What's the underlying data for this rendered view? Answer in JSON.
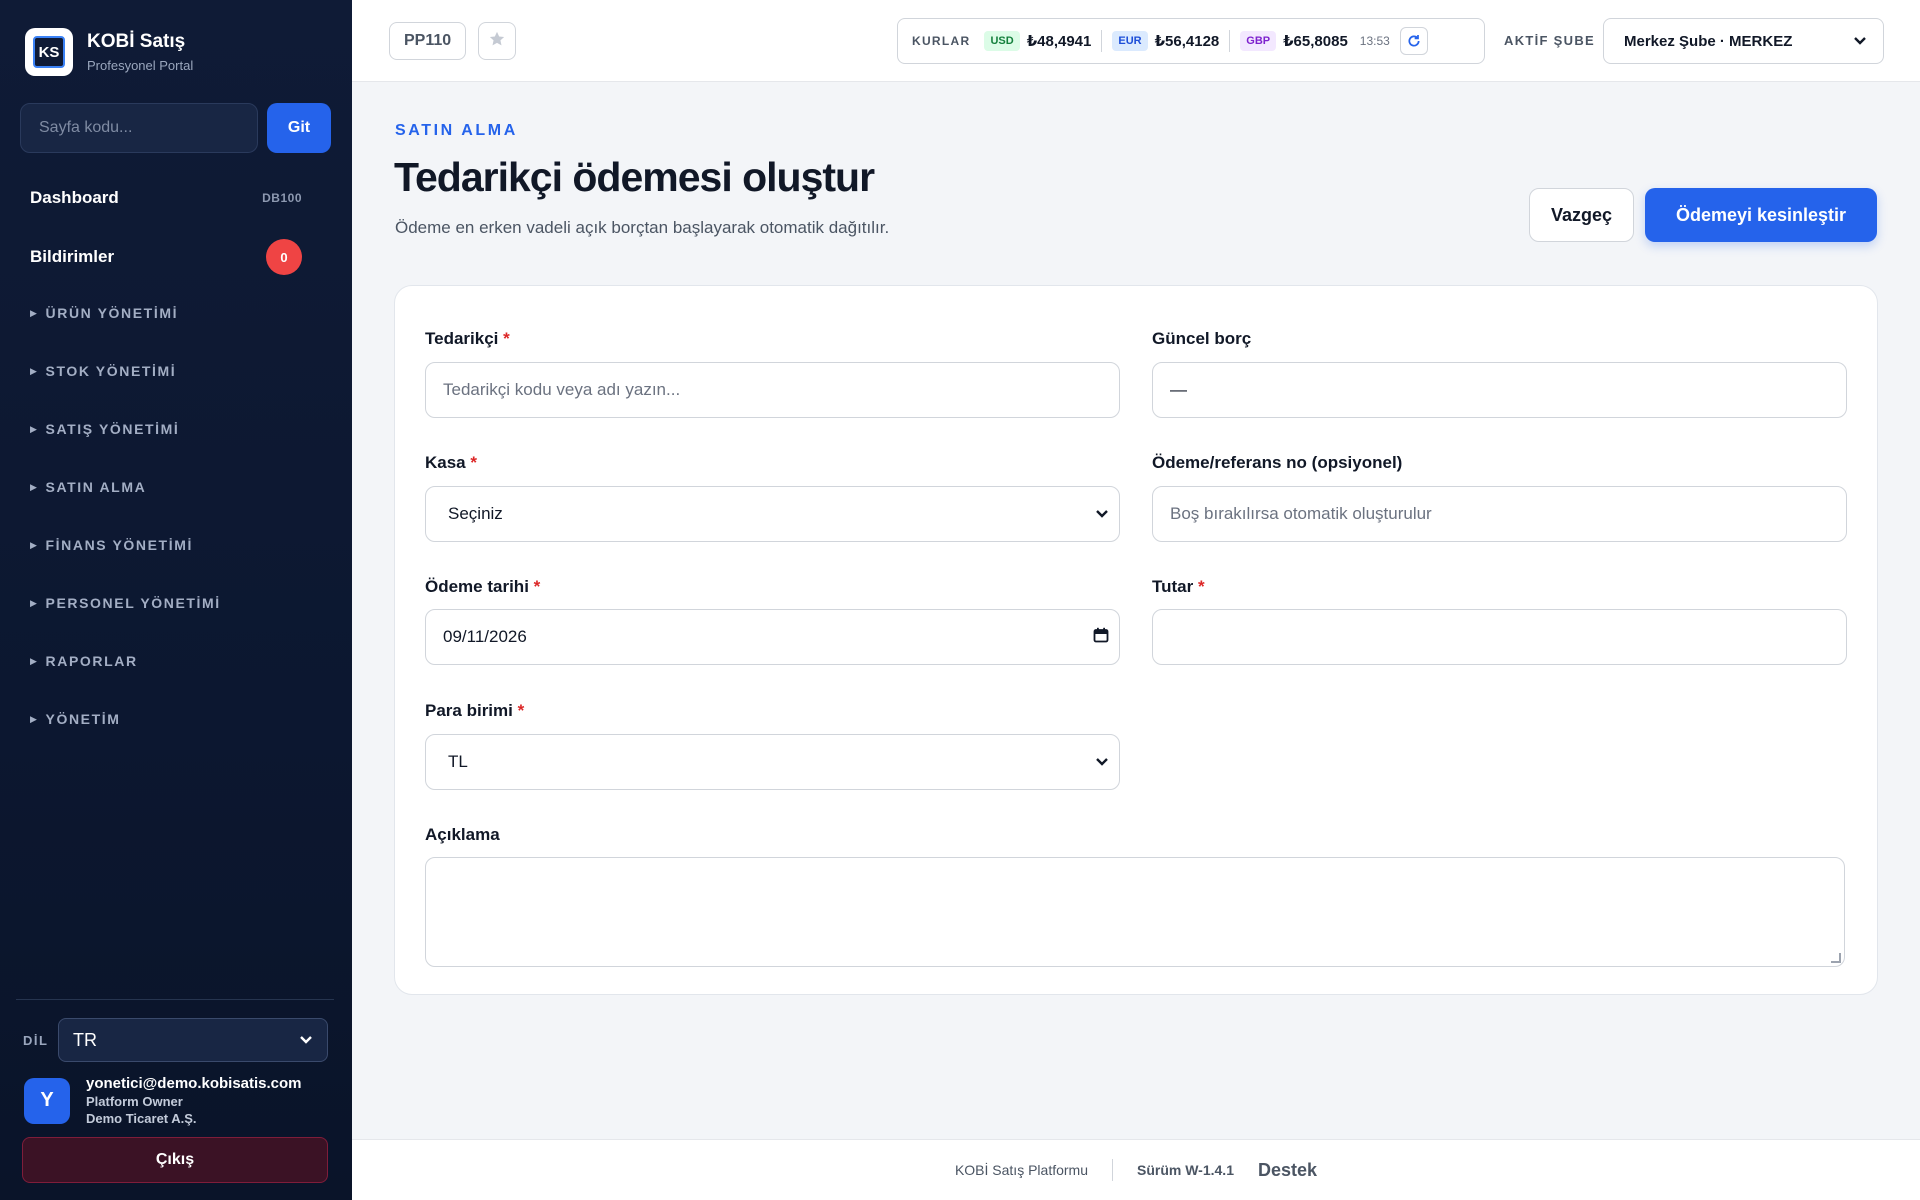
{
  "brand": {
    "logo": "KS",
    "name": "KOBİ Satış",
    "subtitle": "Profesyonel Portal"
  },
  "sidebar": {
    "search_placeholder": "Sayfa kodu...",
    "go_label": "Git",
    "dashboard": {
      "label": "Dashboard",
      "code": "DB100"
    },
    "notifications": {
      "label": "Bildirimler",
      "count": "0"
    },
    "groups": [
      "ÜRÜN YÖNETİMİ",
      "STOK YÖNETİMİ",
      "SATIŞ YÖNETİMİ",
      "SATIN ALMA",
      "FİNANS YÖNETİMİ",
      "PERSONEL YÖNETİMİ",
      "RAPORLAR",
      "YÖNETİM"
    ],
    "language_label": "DİL",
    "language_value": "TR",
    "user": {
      "initial": "Y",
      "email": "yonetici@demo.kobisatis.com",
      "role": "Platform Owner",
      "company": "Demo Ticaret A.Ş."
    },
    "logout_label": "Çıkış"
  },
  "topbar": {
    "page_code": "PP110",
    "rates_label": "KURLAR",
    "rates": [
      {
        "currency": "USD",
        "value": "₺48,4941",
        "tag_bg": "#dcfce7",
        "tag_color": "#15803d"
      },
      {
        "currency": "EUR",
        "value": "₺56,4128",
        "tag_bg": "#dbeafe",
        "tag_color": "#1d4ed8"
      },
      {
        "currency": "GBP",
        "value": "₺65,8085",
        "tag_bg": "#f3e8ff",
        "tag_color": "#7e22ce"
      }
    ],
    "rates_time": "13:53",
    "branch_label": "AKTİF ŞUBE",
    "branch_value": "Merkez Şube · MERKEZ"
  },
  "page": {
    "eyebrow": "SATIN ALMA",
    "title": "Tedarikçi ödemesi oluştur",
    "description": "Ödeme en erken vadeli açık borçtan başlayarak otomatik dağıtılır.",
    "cancel_label": "Vazgeç",
    "confirm_label": "Ödemeyi kesinleştir"
  },
  "form": {
    "supplier": {
      "label": "Tedarikçi",
      "placeholder": "Tedarikçi kodu veya adı yazın..."
    },
    "current_debt": {
      "label": "Güncel borç",
      "value": "—"
    },
    "cashbox": {
      "label": "Kasa",
      "value": "Seçiniz"
    },
    "reference": {
      "label": "Ödeme/referans no (opsiyonel)",
      "placeholder": "Boş bırakılırsa otomatik oluşturulur"
    },
    "payment_date": {
      "label": "Ödeme tarihi",
      "value": "09/11/2026"
    },
    "amount": {
      "label": "Tutar",
      "value": ""
    },
    "currency": {
      "label": "Para birimi",
      "value": "TL"
    },
    "description": {
      "label": "Açıklama"
    },
    "required_mark": "*"
  },
  "footer": {
    "platform": "KOBİ Satış Platformu",
    "version": "Sürüm W-1.4.1",
    "support": "Destek"
  },
  "colors": {
    "accent": "#2563eb",
    "sidebar_bg": "#0f1b36",
    "required": "#dc2626",
    "badge": "#ef4444"
  }
}
